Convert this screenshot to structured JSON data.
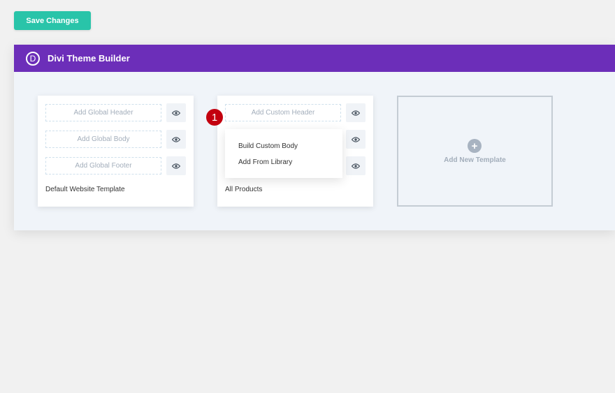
{
  "toolbar": {
    "save_label": "Save Changes"
  },
  "builder": {
    "logo_letter": "D",
    "title": "Divi Theme Builder"
  },
  "default_template": {
    "header_slot": "Add Global Header",
    "body_slot": "Add Global Body",
    "footer_slot": "Add Global Footer",
    "name": "Default Website Template"
  },
  "products_template": {
    "header_slot": "Add Custom Header",
    "name": "All Products",
    "body_menu": {
      "items": [
        "Build Custom Body",
        "Add From Library"
      ]
    }
  },
  "step_badge": "1",
  "new_template": {
    "plus": "+",
    "label": "Add New Template"
  },
  "colors": {
    "accent_teal": "#29c4a9",
    "header_purple": "#6c2eb9",
    "badge_red": "#c3000f"
  },
  "icons": {
    "eye": "eye-icon",
    "plus": "plus-icon",
    "logo": "divi-logo-icon"
  }
}
